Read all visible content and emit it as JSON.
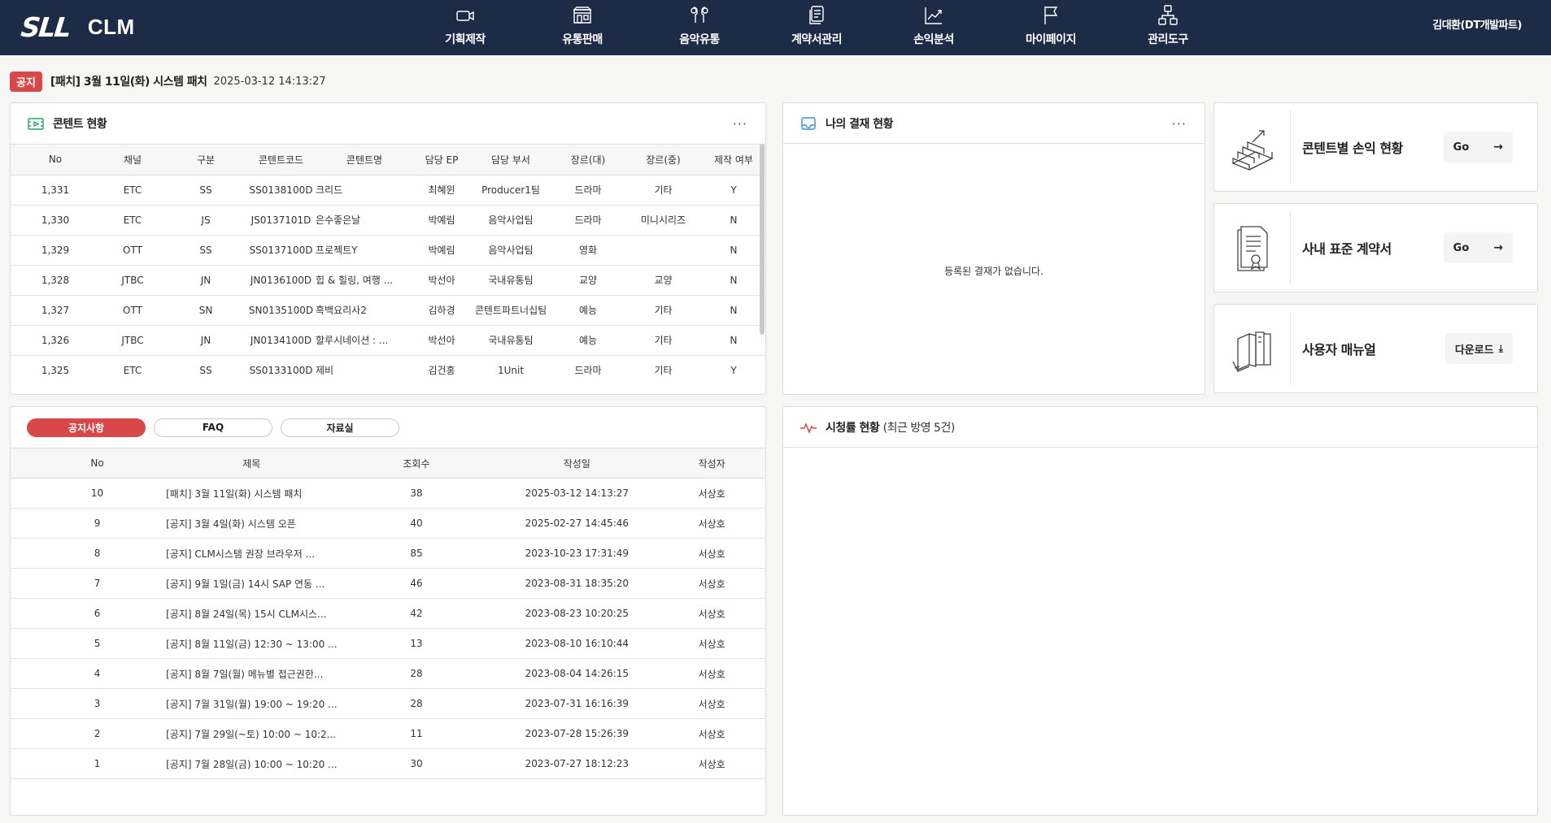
{
  "header": {
    "logo_mark": "SLL",
    "logo_text": "CLM",
    "nav": [
      {
        "label": "기획제작",
        "icon": "camera-icon"
      },
      {
        "label": "유통판매",
        "icon": "store-icon"
      },
      {
        "label": "음악유통",
        "icon": "earphones-icon"
      },
      {
        "label": "계약서관리",
        "icon": "documents-icon"
      },
      {
        "label": "손익분석",
        "icon": "chart-icon"
      },
      {
        "label": "마이페이지",
        "icon": "flag-icon"
      },
      {
        "label": "관리도구",
        "icon": "org-chart-icon"
      }
    ],
    "user": "김대환(DT개발파트)"
  },
  "notice": {
    "badge": "공지",
    "title": "[패치] 3월 11일(화) 시스템 패치",
    "date": "2025-03-12 14:13:27"
  },
  "content_status": {
    "title": "콘텐트 현황",
    "more": "···",
    "columns": [
      "No",
      "채널",
      "구분",
      "콘텐트코드",
      "콘텐트명",
      "담당 EP",
      "담당 부서",
      "장르(대)",
      "장르(중)",
      "제작 여부"
    ],
    "rows": [
      [
        "1,331",
        "ETC",
        "SS",
        "SS0138100D",
        "크리드",
        "최혜윈",
        "Producer1팀",
        "드라마",
        "기타",
        "Y"
      ],
      [
        "1,330",
        "ETC",
        "JS",
        "JS0137101D",
        "은수좋은날",
        "박예림",
        "음악사업팀",
        "드라마",
        "미니시리즈",
        "N"
      ],
      [
        "1,329",
        "OTT",
        "SS",
        "SS0137100D",
        "프로젝트Y",
        "박예림",
        "음악사업팀",
        "영화",
        "",
        "N"
      ],
      [
        "1,328",
        "JTBC",
        "JN",
        "JN0136100D",
        "힙 & 힐링, 여행 ...",
        "박선아",
        "국내유통팀",
        "교양",
        "교양",
        "N"
      ],
      [
        "1,327",
        "OTT",
        "SN",
        "SN0135100D",
        "흑백요리사2",
        "김하경",
        "콘텐트파트너십팀",
        "예능",
        "기타",
        "N"
      ],
      [
        "1,326",
        "JTBC",
        "JN",
        "JN0134100D",
        "할루시네이션 : ...",
        "박선아",
        "국내유통팀",
        "예능",
        "기타",
        "N"
      ],
      [
        "1,325",
        "ETC",
        "SS",
        "SS0133100D",
        "제비",
        "김건홍",
        "1Unit",
        "드라마",
        "기타",
        "Y"
      ]
    ]
  },
  "approval": {
    "title": "나의 결재 현황",
    "more": "···",
    "empty": "등록된 결재가 없습니다."
  },
  "quick_links": [
    {
      "title": "콘텐트별 손익 현황",
      "button": "Go",
      "arrow": "→",
      "icon": "stairs-icon"
    },
    {
      "title": "사내 표준 계약서",
      "button": "Go",
      "arrow": "→",
      "icon": "certificate-icon"
    },
    {
      "title": "사용자 매뉴얼",
      "button": "다운로드",
      "arrow": "⤓",
      "icon": "books-icon"
    }
  ],
  "board": {
    "tabs": [
      "공지사항",
      "FAQ",
      "자료실"
    ],
    "active_tab": 0,
    "columns": [
      "No",
      "제목",
      "조회수",
      "작성일",
      "작성자"
    ],
    "rows": [
      [
        "10",
        "[패치] 3월 11일(화) 시스템 패치",
        "38",
        "2025-03-12 14:13:27",
        "서상호"
      ],
      [
        "9",
        "[공지] 3월 4일(화) 시스템 오픈",
        "40",
        "2025-02-27 14:45:46",
        "서상호"
      ],
      [
        "8",
        "[공지] CLM시스템 권장 브라우저 ...",
        "85",
        "2023-10-23 17:31:49",
        "서상호"
      ],
      [
        "7",
        "[공지] 9월 1일(금) 14시 SAP 연동 ...",
        "46",
        "2023-08-31 18:35:20",
        "서상호"
      ],
      [
        "6",
        "[공지] 8월 24일(목) 15시 CLM시스...",
        "42",
        "2023-08-23 10:20:25",
        "서상호"
      ],
      [
        "5",
        "[공지] 8월 11일(금) 12:30 ~ 13:00 ...",
        "13",
        "2023-08-10 16:10:44",
        "서상호"
      ],
      [
        "4",
        "[공지] 8월 7일(월) 메뉴별 접근권한...",
        "28",
        "2023-08-04 14:26:15",
        "서상호"
      ],
      [
        "3",
        "[공지] 7월 31일(월) 19:00 ~ 19:20 ...",
        "28",
        "2023-07-31 16:16:39",
        "서상호"
      ],
      [
        "2",
        "[공지] 7월 29일(~토) 10:00 ~ 10:2...",
        "11",
        "2023-07-28 15:26:39",
        "서상호"
      ],
      [
        "1",
        "[공지] 7월 28일(금) 10:00 ~ 10:20 ...",
        "30",
        "2023-07-27 18:12:23",
        "서상호"
      ]
    ]
  },
  "ratings": {
    "title": "시청률 현황",
    "subtitle": "(최근 방영 5건)"
  },
  "colors": {
    "header_bg": "#1d2b47",
    "accent": "#d94848"
  }
}
